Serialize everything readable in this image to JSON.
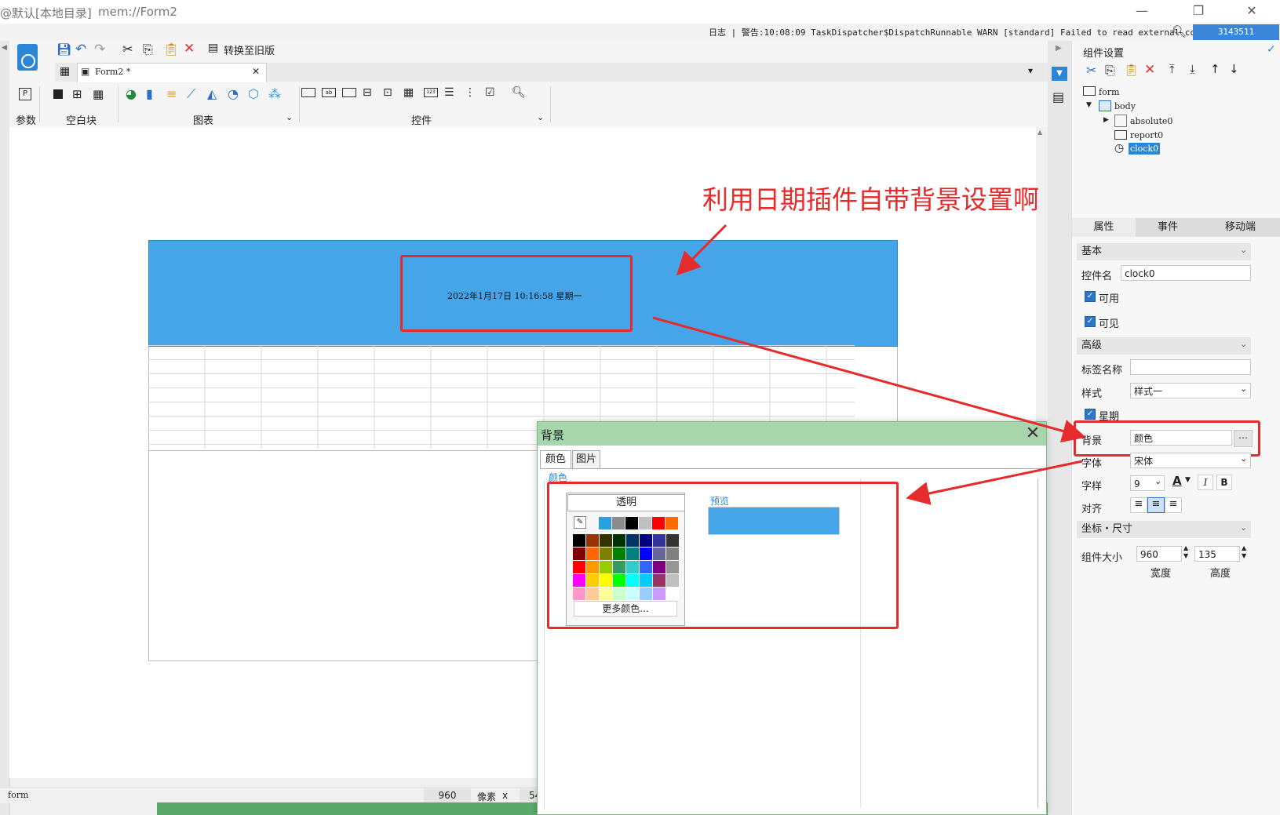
{
  "window": {
    "title_left": "@默认[本地目录]",
    "title_right": "mem://Form2"
  },
  "logbar": {
    "text": "日志 | 警告:10:08:09 TaskDispatcher$DispatchRunnable WARN [standard] Failed to read external conf...",
    "badge": "3143511"
  },
  "toolbar": {
    "convert_label": "转换至旧版",
    "tab_label": "Form2 *",
    "group_param": "参数",
    "group_blank": "空白块",
    "group_chart": "图表",
    "group_widget": "控件"
  },
  "canvas": {
    "annotation": "利用日期插件自带背景设置啊",
    "date_text": "2022年1月17日   10:16:58   星期一"
  },
  "statusbar": {
    "left": "form",
    "width_value": "960",
    "unit": "像素",
    "times": "x",
    "height_value": "54"
  },
  "rightpanel": {
    "header": "组件设置",
    "tree": {
      "form": "form",
      "body": "body",
      "absolute": "absolute0",
      "report": "report0",
      "clock": "clock0"
    },
    "tabs": [
      "属性",
      "事件",
      "移动端"
    ],
    "basic_section": "基本",
    "widget_name_label": "控件名",
    "widget_name_value": "clock0",
    "enabled_label": "可用",
    "visible_label": "可见",
    "advanced_section": "高级",
    "tag_name_label": "标签名称",
    "style_label": "样式",
    "style_value": "样式一",
    "weekday_label": "星期",
    "background_label": "背景",
    "background_value": "颜色",
    "font_label": "字体",
    "font_value": "宋体",
    "fontstyle_label": "字样",
    "font_size": "9",
    "align_label": "对齐",
    "coord_section": "坐标・尺寸",
    "size_label": "组件大小",
    "width_value": "960",
    "height_value": "135",
    "width_caption": "宽度",
    "height_caption": "高度"
  },
  "dialog": {
    "title": "背景",
    "tab_color": "颜色",
    "tab_image": "图片",
    "section_label": "颜色",
    "transparent": "透明",
    "more_colors": "更多颜色...",
    "preview_label": "预览",
    "preview_color": "#45a5e8"
  },
  "palette": {
    "recent": [
      "#2aa0e0",
      "#8c8c8c",
      "#000000",
      "#c0c0c0",
      "#ff0000",
      "#ff6a00"
    ],
    "rows": [
      [
        "#000000",
        "#993300",
        "#333300",
        "#003300",
        "#003366",
        "#000080",
        "#333399",
        "#333333"
      ],
      [
        "#800000",
        "#ff6600",
        "#808000",
        "#008000",
        "#008080",
        "#0000ff",
        "#666699",
        "#808080"
      ],
      [
        "#ff0000",
        "#ff9900",
        "#99cc00",
        "#339966",
        "#33cccc",
        "#3366ff",
        "#800080",
        "#969696"
      ],
      [
        "#ff00ff",
        "#ffcc00",
        "#ffff00",
        "#00ff00",
        "#00ffff",
        "#00ccff",
        "#993366",
        "#c0c0c0"
      ],
      [
        "#ff99cc",
        "#ffcc99",
        "#ffff99",
        "#ccffcc",
        "#ccffff",
        "#99ccff",
        "#cc99ff",
        "#ffffff"
      ]
    ]
  },
  "colors": {
    "accent_red": "#e52b2b",
    "clock_bg": "#45a5e8",
    "dialog_title": "#a7d5ac"
  }
}
